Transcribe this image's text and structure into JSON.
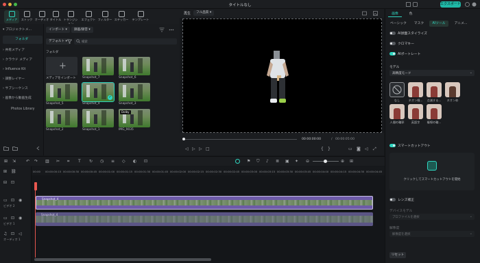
{
  "app": {
    "title": "タイトルなし",
    "export_label": "エクスポート"
  },
  "top_tabs": [
    "メディア",
    "ストック",
    "オーディオ",
    "タイトル",
    "トランジション",
    "エフェクト",
    "フィルター",
    "ステッカー",
    "テンプレート"
  ],
  "sidebar": {
    "items": [
      "プロジェクトメ...",
      "フォルダ",
      "共有メディア",
      "クラウド メディア",
      "Influence Kit",
      "調整レイヤー",
      "サブシーケンス",
      "画像から動画生成",
      "Photos Library"
    ]
  },
  "media": {
    "import_label": "インポート",
    "record_label": "録画/録音",
    "sort_label": "デフォルト",
    "search_placeholder": "検索",
    "folder_label": "フォルダ",
    "items": [
      {
        "label": "メディアをインポート"
      },
      {
        "label": "Snapshot_7"
      },
      {
        "label": "Snapshot_6"
      },
      {
        "label": "Snapshot_5"
      },
      {
        "label": "Snapshot_4"
      },
      {
        "label": "Snapshot_3"
      },
      {
        "label": "Snapshot_2"
      },
      {
        "label": "Snapshot_1"
      },
      {
        "label": "IMG_9035"
      }
    ],
    "dolby_badge": "Dolby"
  },
  "preview": {
    "player_label": "再生",
    "quality_label": "フル品質",
    "current_time": "00:00:00:00",
    "separator": "/",
    "total_time": "00:00:05:00"
  },
  "right_panel": {
    "top_tabs": [
      "画像",
      "色"
    ],
    "sub_tabs": [
      "ベーシック",
      "マスク",
      "AIツール",
      "アニメ..."
    ],
    "toggles": [
      {
        "label": "AI顔面スタイライズ",
        "on": false
      },
      {
        "label": "クロマキー",
        "on": false
      },
      {
        "label": "AIポートレート",
        "on": true
      }
    ],
    "model_label": "モデル",
    "model_value": "高精度モード",
    "presets": [
      {
        "label": "なし"
      },
      {
        "label": "ネオン線..."
      },
      {
        "label": "点滅する..."
      },
      {
        "label": "ネオン枠"
      },
      {
        "label": "人間の輪郭"
      },
      {
        "label": "英語字"
      },
      {
        "label": "複線の輪..."
      }
    ],
    "smart_cutout_label": "スマートカットアウト",
    "smart_cutout_hint": "クリックしてスマートカットアウトを開始",
    "lens_label": "レンズ補正",
    "device_model_label": "デバイスモデル",
    "device_model_value": "プロファイルを選択",
    "resolution_label": "解像度",
    "resolution_value": "解像度を選択",
    "reset_label": "リセット",
    "accent_color": "#2fd6c0"
  },
  "timeline": {
    "ruler_ticks": [
      "00:00",
      "00:00:00:15",
      "00:00:00:30",
      "00:00:00:45",
      "00:00:01:00",
      "00:00:01:15",
      "00:00:01:30",
      "00:00:01:45",
      "00:00:02:00",
      "00:00:02:15",
      "00:00:02:30",
      "00:00:02:45",
      "00:00:03:00",
      "00:00:03:15",
      "00:00:03:30",
      "00:00:03:45",
      "00:00:04:00",
      "00:00:04:15",
      "00:00:04:30",
      "00:00:04:45"
    ],
    "tracks": [
      "ビデオ 2",
      "ビデオ 1",
      "オーディオ 1"
    ],
    "clip_top_label": "Snapshot_4",
    "clip_bottom_label": "Snapshot_4"
  }
}
